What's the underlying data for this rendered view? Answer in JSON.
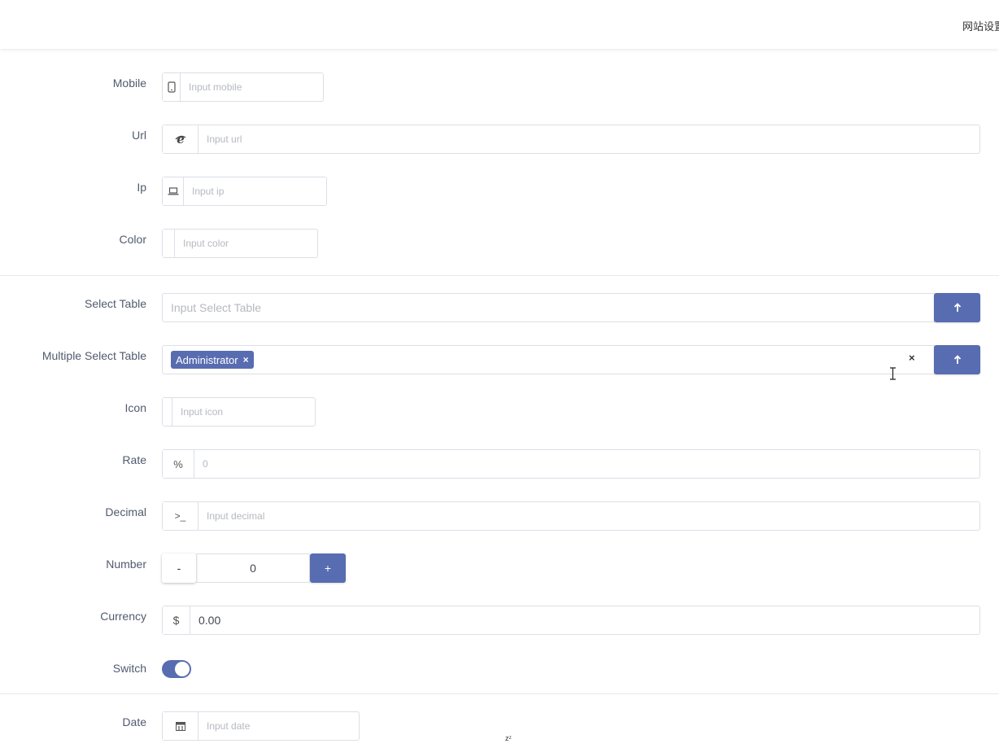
{
  "header": {
    "menu_text": "网站设置"
  },
  "form": {
    "mobile": {
      "label": "Mobile",
      "placeholder": "Input mobile",
      "icon": "mobile-icon"
    },
    "url": {
      "label": "Url",
      "placeholder": "Input url",
      "icon": "internet-explorer-icon"
    },
    "ip": {
      "label": "Ip",
      "placeholder": "Input ip",
      "icon": "laptop-icon"
    },
    "color": {
      "label": "Color",
      "placeholder": "Input color"
    },
    "select_table": {
      "label": "Select Table",
      "placeholder": "Input Select Table",
      "button_icon": "arrow-up-icon"
    },
    "multiple_select_table": {
      "label": "Multiple Select Table",
      "tags": [
        "Administrator"
      ],
      "tag_remove": "×",
      "clear": "×",
      "button_icon": "arrow-up-icon"
    },
    "icon": {
      "label": "Icon",
      "placeholder": "Input icon"
    },
    "rate": {
      "label": "Rate",
      "addon": "%",
      "placeholder": "0"
    },
    "decimal": {
      "label": "Decimal",
      "addon": ">_",
      "placeholder": "Input decimal"
    },
    "number": {
      "label": "Number",
      "minus": "-",
      "value": "0",
      "plus": "+"
    },
    "currency": {
      "label": "Currency",
      "addon": "$",
      "value": "0.00"
    },
    "switch": {
      "label": "Switch",
      "on": true
    },
    "date": {
      "label": "Date",
      "placeholder": "Input date",
      "icon": "calendar-icon"
    }
  },
  "colors": {
    "primary": "#586cb1",
    "border": "#dcdfe6",
    "label": "#515a6e"
  },
  "misc": {
    "sleep_indicator": "zᶻ"
  }
}
